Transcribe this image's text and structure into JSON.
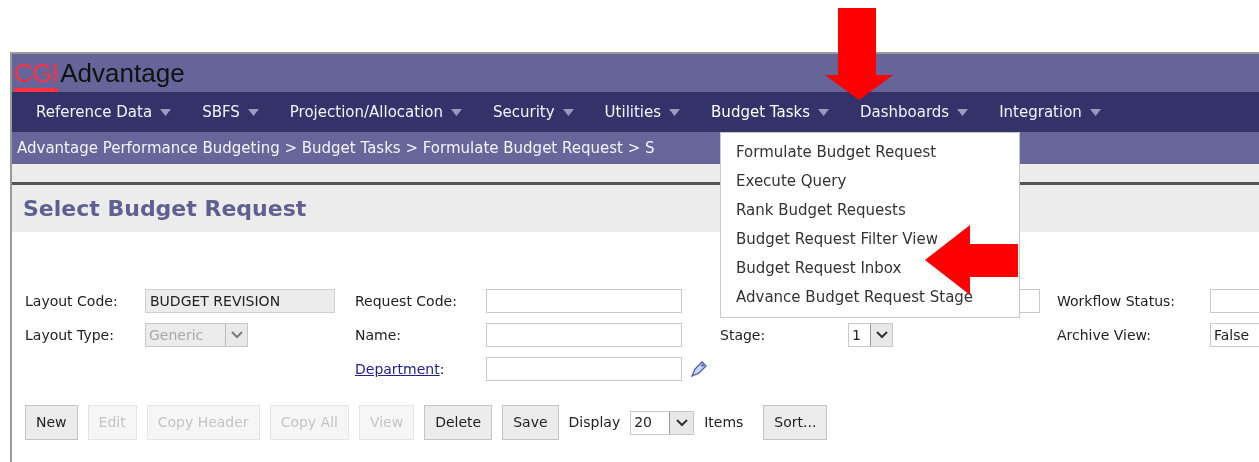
{
  "logo": {
    "brand": "CGI",
    "product": "Advantage"
  },
  "menu": [
    {
      "label": "Reference Data",
      "expanded": false
    },
    {
      "label": "SBFS",
      "expanded": false
    },
    {
      "label": "Projection/Allocation",
      "expanded": false
    },
    {
      "label": "Security",
      "expanded": false
    },
    {
      "label": "Utilities",
      "expanded": false
    },
    {
      "label": "Budget Tasks",
      "expanded": true
    },
    {
      "label": "Dashboards",
      "expanded": false
    },
    {
      "label": "Integration",
      "expanded": false
    }
  ],
  "breadcrumb": "Advantage Performance Budgeting > Budget Tasks > Formulate Budget Request > S",
  "dropdown": [
    "Formulate Budget Request",
    "Execute Query",
    "Rank Budget Requests",
    "Budget Request Filter View",
    "Budget Request Inbox",
    "Advance Budget Request Stage"
  ],
  "page_title": "Select Budget Request",
  "form_rows": [
    [
      {
        "label": "Layout Code:",
        "kind": "text",
        "value": "BUDGET REVISION",
        "disabled": true
      },
      {
        "label": "Request Code:",
        "kind": "text",
        "disabled": false
      },
      {
        "kind": "text",
        "disabled": false
      },
      {
        "label": "Workflow Status:",
        "kind": "text",
        "disabled": false
      }
    ],
    [
      {
        "label": "Layout Type:",
        "kind": "select",
        "value": "Generic",
        "disabled": true
      },
      {
        "label": "Name:",
        "kind": "text",
        "disabled": false
      },
      {
        "label": "Stage:",
        "kind": "select",
        "value": "1",
        "disabled": false
      },
      {
        "label": "Archive View:",
        "kind": "select",
        "value": "False",
        "disabled": false
      }
    ],
    [
      {
        "kind": "empty"
      },
      {
        "label": "Department",
        "label_suffix": ":",
        "kind": "lookup",
        "disabled": false
      }
    ]
  ],
  "toolbar": {
    "buttons": [
      {
        "label": "New",
        "disabled": false
      },
      {
        "label": "Edit",
        "disabled": true
      },
      {
        "label": "Copy Header",
        "disabled": true
      },
      {
        "label": "Copy All",
        "disabled": true
      },
      {
        "label": "View",
        "disabled": true
      },
      {
        "label": "Delete",
        "disabled": false
      },
      {
        "label": "Save",
        "disabled": false
      }
    ],
    "display_label": "Display",
    "page_size": "20",
    "items_label": "Items",
    "sort_button": "Sort..."
  }
}
